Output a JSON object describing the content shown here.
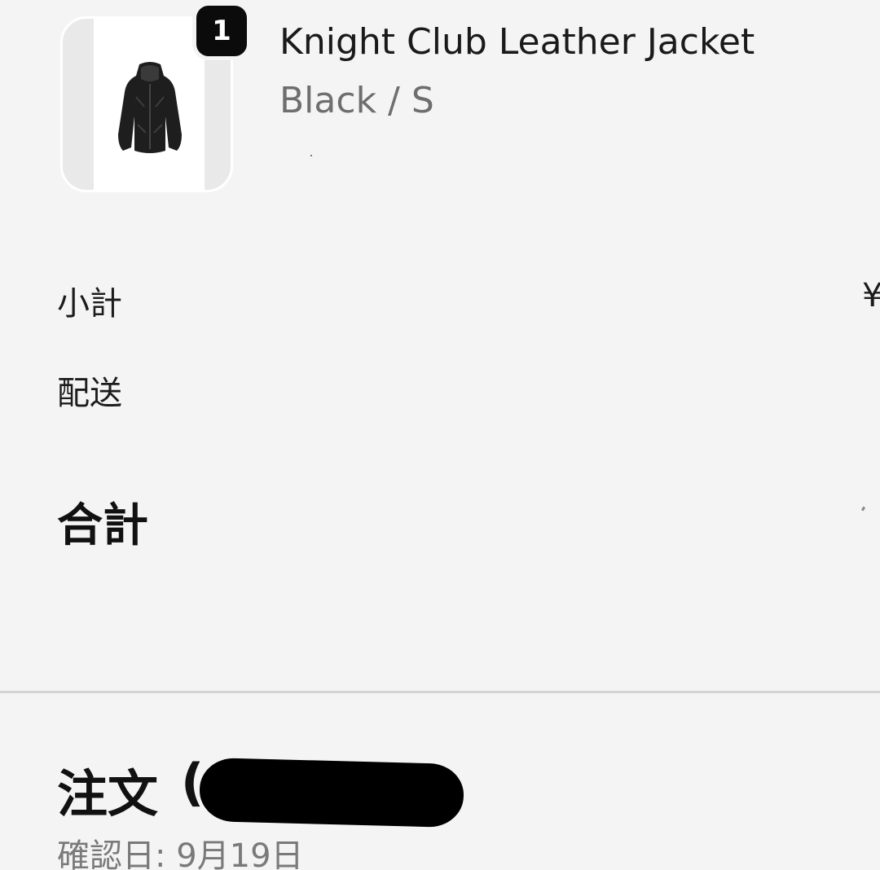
{
  "product": {
    "name": "Knight Club Leather Jacket",
    "variant": "Black / S",
    "quantity": "1",
    "image_icon": "jacket-image"
  },
  "summary": {
    "subtotal_label": "小計",
    "subtotal_value": "¥",
    "shipping_label": "配送",
    "total_label": "合計"
  },
  "order": {
    "title": "注文",
    "paren_open": "(",
    "number_redacted": true,
    "confirmed_date": "確認日: 9月19日"
  },
  "colors": {
    "background": "#f4f4f4",
    "text_primary": "#111111",
    "text_secondary": "#6e6e6e",
    "badge": "#0b0b0b"
  }
}
